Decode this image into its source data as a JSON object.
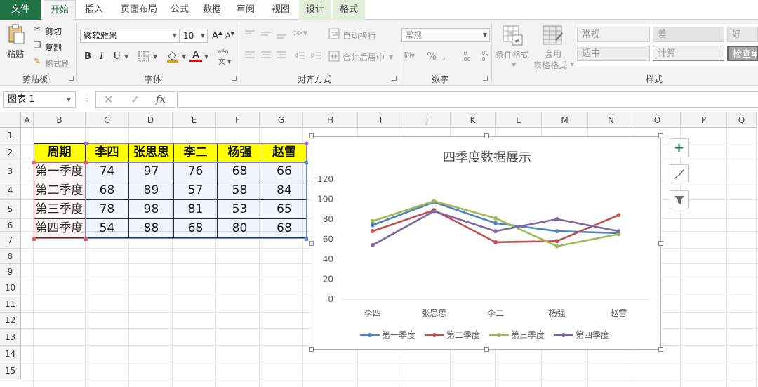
{
  "tabs": [
    {
      "label": "文件"
    },
    {
      "label": "开始"
    },
    {
      "label": "插入"
    },
    {
      "label": "页面布局"
    },
    {
      "label": "公式"
    },
    {
      "label": "数据"
    },
    {
      "label": "审阅"
    },
    {
      "label": "视图"
    },
    {
      "label": "设计"
    },
    {
      "label": "格式"
    }
  ],
  "ribbon": {
    "clipboard": {
      "paste": "粘贴",
      "cut": "剪切",
      "copy": "复制",
      "format_painter": "格式刷",
      "group": "剪贴板"
    },
    "font": {
      "font_name": "微软雅黑",
      "font_size": "10",
      "bold": "B",
      "italic": "I",
      "underline": "U",
      "font_color_glyph": "A",
      "grow": "A",
      "shrink": "A",
      "phonetic": "wén",
      "group": "字体"
    },
    "alignment": {
      "wrap_text": "自动换行",
      "merge_center": "合并后居中",
      "group": "对齐方式"
    },
    "number": {
      "format": "常规",
      "percent": "%",
      "comma": ",",
      "inc_decimal": ".0 .00",
      "dec_decimal": ".00 .0",
      "group": "数字"
    },
    "styles": {
      "conditional_format": "条件格式",
      "table_format_1": "套用",
      "table_format_2": "表格格式",
      "cells": [
        "常规",
        "差",
        "好",
        "适中",
        "计算",
        "检查单"
      ],
      "group": "样式"
    }
  },
  "formula_bar": {
    "name_box": "图表 1",
    "fx": "fx",
    "value": ""
  },
  "columns": [
    "A",
    "B",
    "C",
    "D",
    "E",
    "F",
    "G",
    "H",
    "I",
    "J",
    "K",
    "L",
    "M",
    "N",
    "O",
    "P",
    "Q"
  ],
  "rows": [
    "1",
    "2",
    "3",
    "4",
    "5",
    "6",
    "7",
    "8",
    "9",
    "10",
    "11",
    "12",
    "13",
    "14",
    "15"
  ],
  "table": {
    "header": [
      "周期",
      "李四",
      "张思思",
      "李二",
      "杨强",
      "赵雪"
    ],
    "rows": [
      [
        "第一季度",
        "74",
        "97",
        "76",
        "68",
        "66"
      ],
      [
        "第二季度",
        "68",
        "89",
        "57",
        "58",
        "84"
      ],
      [
        "第三季度",
        "78",
        "98",
        "81",
        "53",
        "65"
      ],
      [
        "第四季度",
        "54",
        "88",
        "68",
        "80",
        "68"
      ]
    ]
  },
  "chart_data": {
    "type": "line",
    "title": "四季度数据展示",
    "categories": [
      "李四",
      "张思思",
      "李二",
      "杨强",
      "赵雪"
    ],
    "series": [
      {
        "name": "第一季度",
        "values": [
          74,
          97,
          76,
          68,
          66
        ],
        "color": "#4f81bd"
      },
      {
        "name": "第二季度",
        "values": [
          68,
          89,
          57,
          58,
          84
        ],
        "color": "#c0504d"
      },
      {
        "name": "第三季度",
        "values": [
          78,
          98,
          81,
          53,
          65
        ],
        "color": "#9bbb59"
      },
      {
        "name": "第四季度",
        "values": [
          54,
          88,
          68,
          80,
          68
        ],
        "color": "#8064a2"
      }
    ],
    "ylim": [
      0,
      120
    ],
    "yticks": [
      "0",
      "20",
      "40",
      "60",
      "80",
      "100",
      "120"
    ],
    "grid": false,
    "legend": "bottom"
  },
  "chart_tools": {
    "add": "+",
    "filter": "filter"
  },
  "colors": {
    "excel_green": "#217346",
    "header_yellow": "#ffff00"
  }
}
